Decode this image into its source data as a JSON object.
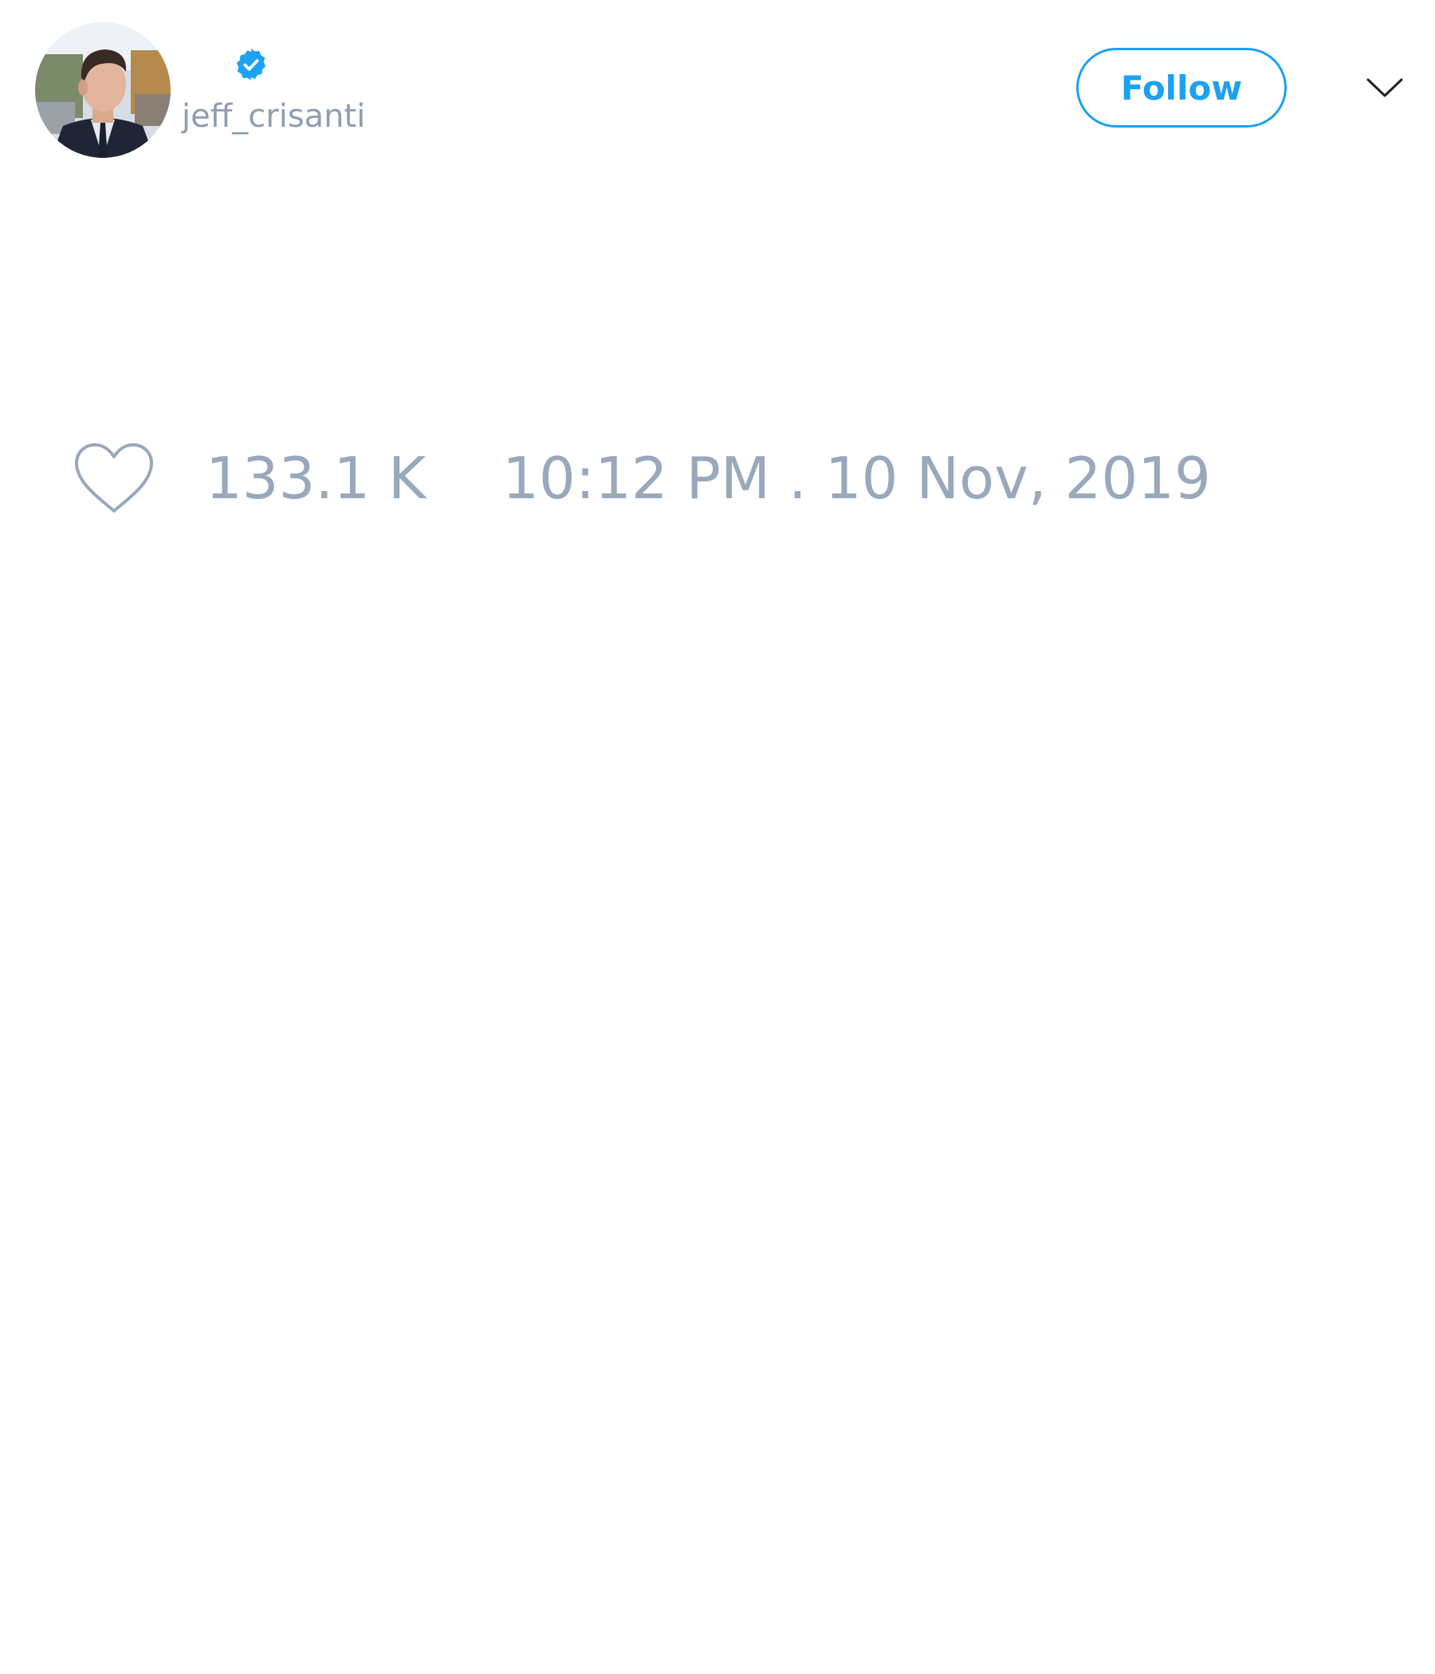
{
  "tweet": {
    "author": {
      "handle": "jeff_crisanti",
      "verified": true,
      "avatar": "profile-photo"
    },
    "follow_label": "Follow",
    "menu_icon": "chevron-down-icon",
    "likes": "133.1 K",
    "timestamp": "10:12 PM . 10 Nov, 2019"
  },
  "colors": {
    "accent": "#1da1f2",
    "muted_text": "#99a8bb"
  }
}
